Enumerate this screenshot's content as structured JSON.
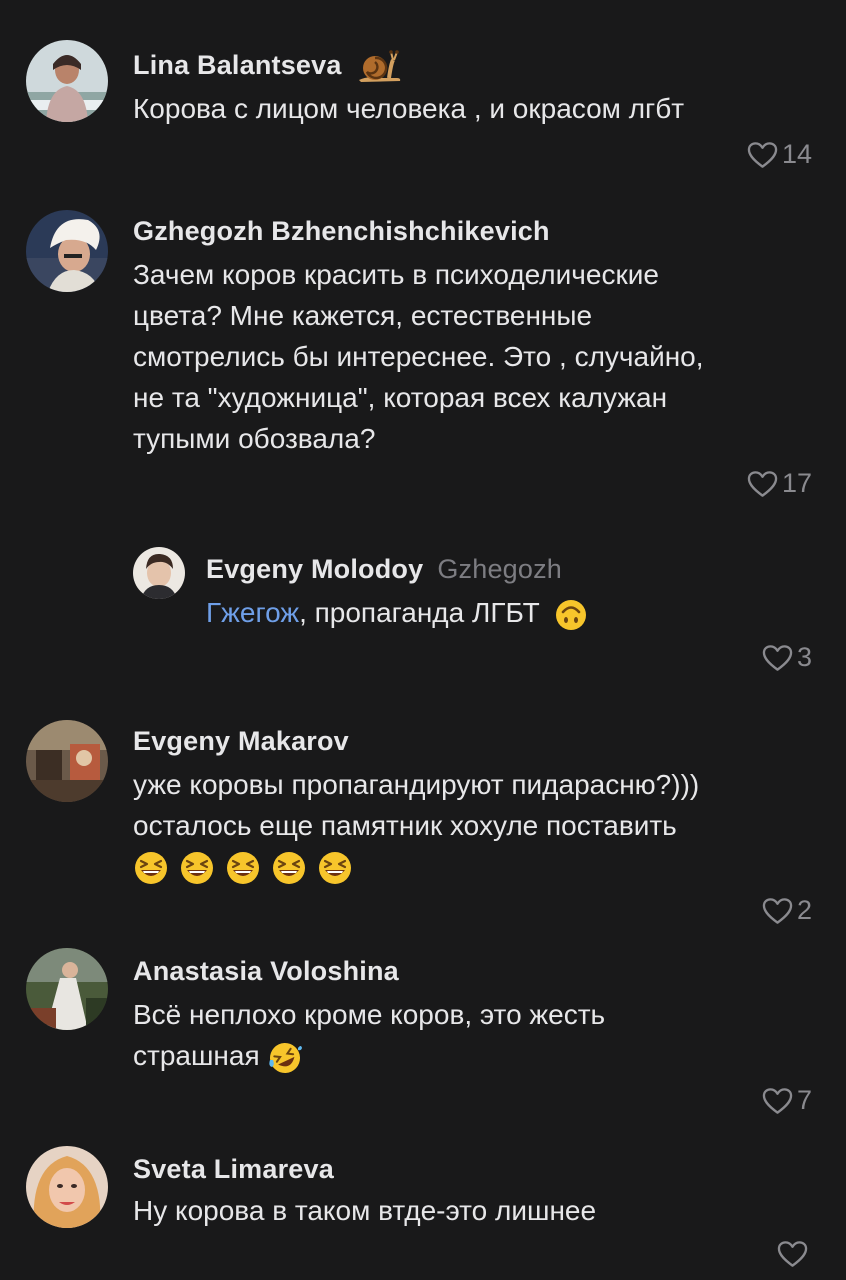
{
  "comments": [
    {
      "author": "Lina Balantseva",
      "badge_icon": "snail-icon",
      "text": "Корова с лицом человека , и окрасом лгбт",
      "likes": "14"
    },
    {
      "author": "Gzhegozh Bzhenchishchikevich",
      "text_lines": [
        "Зачем коров красить в психоделические",
        "цвета? Мне кажется, естественные",
        "смотрелись бы интереснее. Это , случайно,",
        "не та \"художница\", которая всех калужан",
        "тупыми обозвала?"
      ],
      "likes": "17"
    },
    {
      "author": "Evgeny Molodoy",
      "reply_to": "Gzhegozh",
      "mention": "Гжегож",
      "text": ", пропаганда ЛГБТ",
      "trailing_emoji": "upside-down-face-emoji",
      "likes": "3"
    },
    {
      "author": "Evgeny Makarov",
      "text_lines": [
        "уже коровы пропагандируют пидарасню?)))",
        "осталось еще памятник хохуле поставить"
      ],
      "emoji_row": [
        "laughing-face-emoji",
        "laughing-face-emoji",
        "laughing-face-emoji",
        "laughing-face-emoji",
        "laughing-face-emoji"
      ],
      "likes": "2"
    },
    {
      "author": "Anastasia Voloshina",
      "text_lines": [
        "Всё неплохо кроме коров, это жесть",
        "страшная"
      ],
      "trailing_emoji": "rolling-on-floor-laughing-emoji",
      "likes": "7"
    },
    {
      "author": "Sveta Limareva",
      "text": "Ну корова в таком втде-это лишнее",
      "likes": ""
    }
  ],
  "colors": {
    "background": "#19191a",
    "text": "#e7e7e9",
    "muted": "#8a8a8f",
    "mention": "#6f9fe8"
  }
}
